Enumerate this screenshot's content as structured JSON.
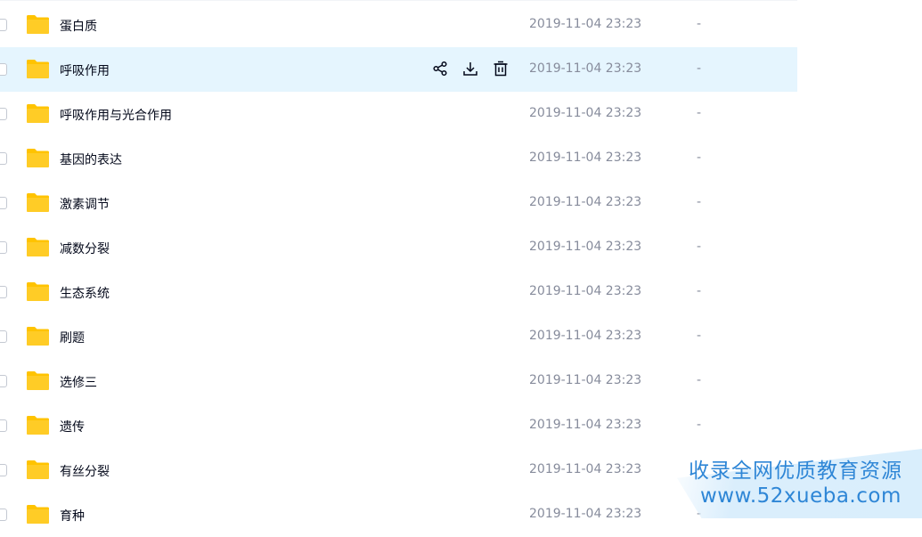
{
  "files": [
    {
      "name": "蛋白质",
      "modified": "2019-11-04 23:23",
      "size": "-"
    },
    {
      "name": "呼吸作用",
      "modified": "2019-11-04 23:23",
      "size": "-",
      "hover": true
    },
    {
      "name": "呼吸作用与光合作用",
      "modified": "2019-11-04 23:23",
      "size": "-"
    },
    {
      "name": "基因的表达",
      "modified": "2019-11-04 23:23",
      "size": "-"
    },
    {
      "name": "激素调节",
      "modified": "2019-11-04 23:23",
      "size": "-"
    },
    {
      "name": "减数分裂",
      "modified": "2019-11-04 23:23",
      "size": "-"
    },
    {
      "name": "生态系统",
      "modified": "2019-11-04 23:23",
      "size": "-"
    },
    {
      "name": "刷题",
      "modified": "2019-11-04 23:23",
      "size": "-"
    },
    {
      "name": "选修三",
      "modified": "2019-11-04 23:23",
      "size": "-"
    },
    {
      "name": "遗传",
      "modified": "2019-11-04 23:23",
      "size": "-"
    },
    {
      "name": "有丝分裂",
      "modified": "2019-11-04 23:23",
      "size": "-"
    },
    {
      "name": "育种",
      "modified": "2019-11-04 23:23",
      "size": "-"
    }
  ],
  "row_actions": [
    {
      "icon": "share-icon"
    },
    {
      "icon": "download-icon"
    },
    {
      "icon": "delete-icon"
    }
  ],
  "colors": {
    "folder": "#ffc300",
    "hover_row": "#e5f5fe",
    "date_text": "#878c9c",
    "watermark_text": "#2e86d6"
  },
  "watermark": {
    "line1": "收录全网优质教育资源",
    "line2": "www.52xueba.com"
  }
}
